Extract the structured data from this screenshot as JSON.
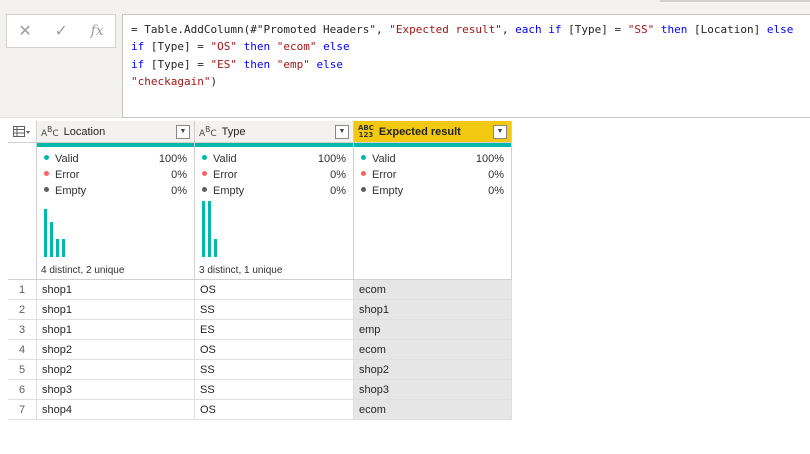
{
  "formula_bar": {
    "cancel_icon": "x-icon",
    "confirm_icon": "check-icon",
    "fx_label": "fx",
    "formula": {
      "l1_prefix": "= Table.AddColumn(#\"Promoted Headers\", ",
      "l1_str": "\"Expected result\"",
      "l1_mid": ", ",
      "l1_kw1": "each if",
      "l1_part2": " [Type] = ",
      "l1_str2": "\"SS\"",
      "l1_kw2": " then",
      "l1_part3": " [Location] ",
      "l1_kw3": "else",
      "l2_kw1": "if",
      "l2_part": " [Type] = ",
      "l2_str": "\"OS\"",
      "l2_kw2": " then ",
      "l2_str2": "\"ecom\"",
      "l2_kw3": " else",
      "l3_kw1": "if",
      "l3_part": " [Type] = ",
      "l3_str": "\"ES\"",
      "l3_kw2": " then ",
      "l3_str2": "\"emp\"",
      "l3_kw3": " else",
      "l4_str": "\"checkagain\"",
      "l4_end": ")"
    }
  },
  "columns": [
    {
      "name": "Location",
      "type_icon": "ABC",
      "valid": "100%",
      "error": "0%",
      "empty": "0%",
      "distinct": "4 distinct, 2 unique",
      "hist": [
        0.85,
        0.62,
        0.32,
        0.32
      ]
    },
    {
      "name": "Type",
      "type_icon": "ABC",
      "valid": "100%",
      "error": "0%",
      "empty": "0%",
      "distinct": "3 distinct, 1 unique",
      "hist": [
        1.0,
        1.0,
        0.32
      ]
    },
    {
      "name": "Expected result",
      "type_icon": "ABC 123",
      "valid": "100%",
      "error": "0%",
      "empty": "0%",
      "distinct": "",
      "hist": []
    }
  ],
  "quality_labels": {
    "valid": "Valid",
    "error": "Error",
    "empty": "Empty"
  },
  "rows": [
    {
      "n": "1",
      "location": "shop1",
      "type": "OS",
      "expected": "ecom"
    },
    {
      "n": "2",
      "location": "shop1",
      "type": "SS",
      "expected": "shop1"
    },
    {
      "n": "3",
      "location": "shop1",
      "type": "ES",
      "expected": "emp"
    },
    {
      "n": "4",
      "location": "shop2",
      "type": "OS",
      "expected": "ecom"
    },
    {
      "n": "5",
      "location": "shop2",
      "type": "SS",
      "expected": "shop2"
    },
    {
      "n": "6",
      "location": "shop3",
      "type": "SS",
      "expected": "shop3"
    },
    {
      "n": "7",
      "location": "shop4",
      "type": "OS",
      "expected": "ecom"
    }
  ],
  "colors": {
    "accent_teal": "#01b8aa",
    "selected_header": "#f2c811",
    "error": "#fd625e"
  }
}
